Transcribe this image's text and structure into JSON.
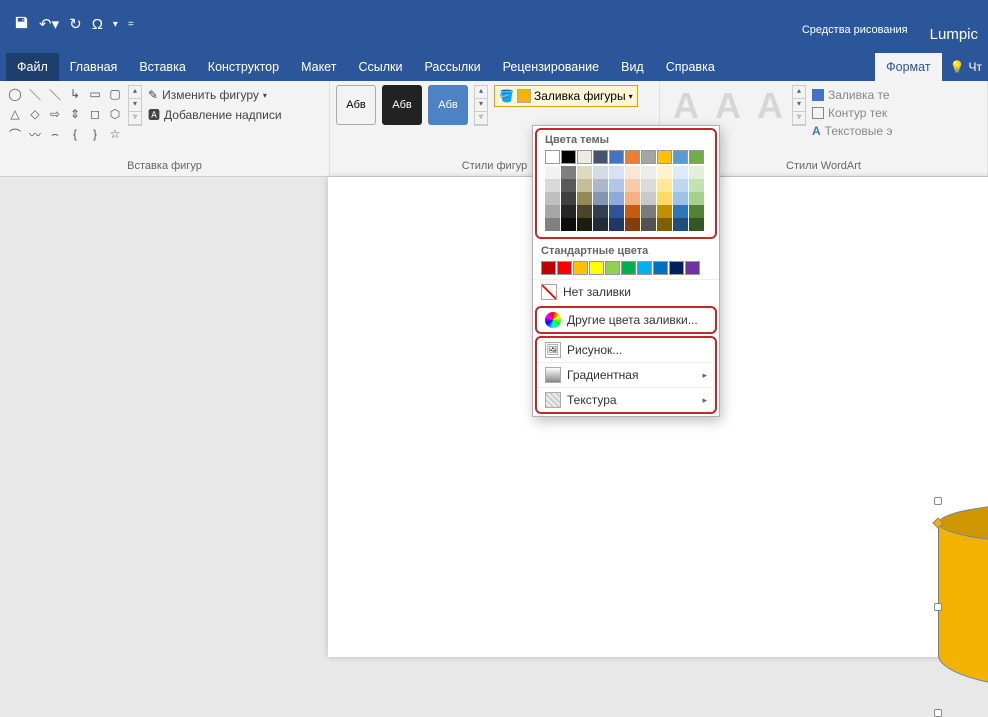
{
  "qat": {
    "symbol": "Ω"
  },
  "title_right": {
    "context_tab": "Средства рисования",
    "brand": "Lumpic"
  },
  "tabs": {
    "file": "Файл",
    "items": [
      "Главная",
      "Вставка",
      "Конструктор",
      "Макет",
      "Ссылки",
      "Рассылки",
      "Рецензирование",
      "Вид",
      "Справка"
    ],
    "active": "Формат",
    "tell_me": "Чт"
  },
  "ribbon": {
    "insert_shapes": {
      "edit_shape": "Изменить фигуру",
      "text_box": "Добавление надписи",
      "label": "Вставка фигур"
    },
    "shape_styles": {
      "sample_text": "Абв",
      "fill_button": "Заливка фигуры",
      "label": "Стили фигур"
    },
    "wordart": {
      "fill_text": "Заливка те",
      "outline_text": "Контур тек",
      "effects_text": "Текстовые э",
      "label": "Стили WordArt"
    }
  },
  "dropdown": {
    "theme_label": "Цвета темы",
    "theme_top": [
      "#ffffff",
      "#000000",
      "#eeece1",
      "#44546a",
      "#4472c4",
      "#ed7d31",
      "#a5a5a5",
      "#ffc000",
      "#5b9bd5",
      "#70ad47"
    ],
    "theme_shades": [
      [
        "#f2f2f2",
        "#7f7f7f",
        "#ddd9c3",
        "#d6dce4",
        "#d9e1f2",
        "#fbe5d6",
        "#ededed",
        "#fff2cc",
        "#deebf6",
        "#e2efda"
      ],
      [
        "#d9d9d9",
        "#595959",
        "#c4bd97",
        "#adb9ca",
        "#b4c6e7",
        "#f7caac",
        "#dbdbdb",
        "#ffe699",
        "#bdd7ee",
        "#c5e0b3"
      ],
      [
        "#bfbfbf",
        "#404040",
        "#948a54",
        "#8496b0",
        "#8eaadb",
        "#f4b183",
        "#c9c9c9",
        "#ffd965",
        "#9cc3e5",
        "#a8d08d"
      ],
      [
        "#a6a6a6",
        "#262626",
        "#4a452a",
        "#323f4f",
        "#2f5496",
        "#c55a11",
        "#7b7b7b",
        "#bf9000",
        "#2e75b5",
        "#538135"
      ],
      [
        "#808080",
        "#0d0d0d",
        "#1e1c11",
        "#222a35",
        "#1f3864",
        "#833c0b",
        "#525252",
        "#7f6000",
        "#1f4e79",
        "#375623"
      ]
    ],
    "standard_label": "Стандартные цвета",
    "standard": [
      "#c00000",
      "#ff0000",
      "#ffc000",
      "#ffff00",
      "#92d050",
      "#00b050",
      "#00b0f0",
      "#0070c0",
      "#002060",
      "#7030a0"
    ],
    "no_fill": "Нет заливки",
    "more_colors": "Другие цвета заливки...",
    "picture": "Рисунок...",
    "gradient": "Градиентная",
    "texture": "Текстура"
  },
  "shape": {
    "color": "#f3b200"
  }
}
